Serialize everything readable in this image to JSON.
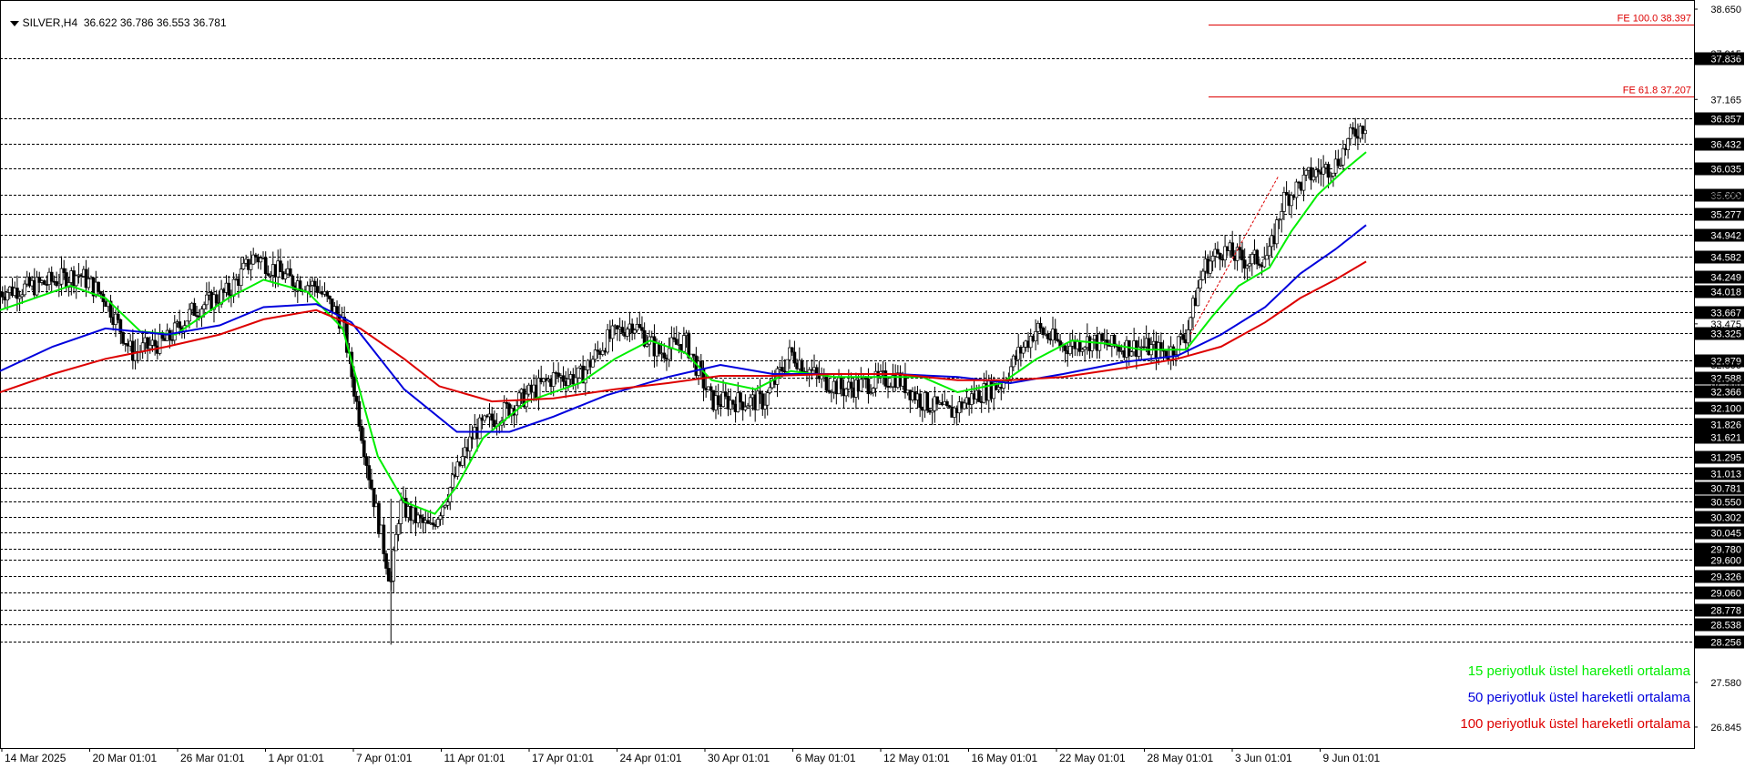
{
  "header": {
    "symbol": "SILVER,H4",
    "ohlc": "36.622 36.786 36.553 36.781"
  },
  "colors": {
    "ema15": "#00ee00",
    "ema50": "#0000dd",
    "ema100": "#dd0000",
    "candles": "#000000",
    "fib": "#dd0000",
    "grid": "#000000"
  },
  "chart_data": {
    "type": "line",
    "title": "SILVER,H4",
    "ylim": [
      26.5,
      38.8
    ],
    "price_scale_ticks": [
      "38.650",
      "37.915",
      "37.165",
      "35.595",
      "33.475",
      "32.800",
      "32.500",
      "27.580",
      "26.845"
    ],
    "level_labels": [
      "37.836",
      "36.857",
      "36.432",
      "36.035",
      "35.600",
      "35.277",
      "34.942",
      "34.582",
      "34.249",
      "34.018",
      "33.667",
      "33.325",
      "32.879",
      "32.588",
      "32.366",
      "32.100",
      "31.826",
      "31.621",
      "31.295",
      "31.013",
      "30.781",
      "30.550",
      "30.302",
      "30.045",
      "29.780",
      "29.600",
      "29.326",
      "29.060",
      "28.778",
      "28.538",
      "28.256"
    ],
    "x_labels": [
      "14 Mar 2025",
      "20 Mar 01:01",
      "26 Mar 01:01",
      "1 Apr 01:01",
      "7 Apr 01:01",
      "11 Apr 01:01",
      "17 Apr 01:01",
      "24 Apr 01:01",
      "30 Apr 01:01",
      "6 May 01:01",
      "12 May 01:01",
      "16 May 01:01",
      "22 May 01:01",
      "28 May 01:01",
      "3 Jun 01:01",
      "9 Jun 01:01"
    ],
    "fib_levels": [
      {
        "label": "FE 100.0 38.397",
        "value": 38.397
      },
      {
        "label": "FE 61.8 37.207",
        "value": 37.207
      }
    ],
    "price_path": [
      {
        "x": 0,
        "y": 34.0
      },
      {
        "x": 0.4,
        "y": 34.1
      },
      {
        "x": 0.9,
        "y": 34.3
      },
      {
        "x": 1.2,
        "y": 33.9
      },
      {
        "x": 1.5,
        "y": 33.0
      },
      {
        "x": 1.9,
        "y": 33.2
      },
      {
        "x": 2.2,
        "y": 33.7
      },
      {
        "x": 2.6,
        "y": 34.0
      },
      {
        "x": 2.9,
        "y": 34.6
      },
      {
        "x": 3.3,
        "y": 34.2
      },
      {
        "x": 3.6,
        "y": 34.1
      },
      {
        "x": 3.9,
        "y": 33.5
      },
      {
        "x": 4.2,
        "y": 31.0
      },
      {
        "x": 4.45,
        "y": 29.2
      },
      {
        "x": 4.55,
        "y": 30.5
      },
      {
        "x": 4.7,
        "y": 30.3
      },
      {
        "x": 4.9,
        "y": 30.1
      },
      {
        "x": 5.1,
        "y": 30.7
      },
      {
        "x": 5.4,
        "y": 31.7
      },
      {
        "x": 5.7,
        "y": 32.0
      },
      {
        "x": 6.0,
        "y": 32.3
      },
      {
        "x": 6.3,
        "y": 32.6
      },
      {
        "x": 6.6,
        "y": 32.6
      },
      {
        "x": 6.9,
        "y": 33.2
      },
      {
        "x": 7.2,
        "y": 33.5
      },
      {
        "x": 7.5,
        "y": 33.0
      },
      {
        "x": 7.8,
        "y": 33.2
      },
      {
        "x": 8.1,
        "y": 32.2
      },
      {
        "x": 8.4,
        "y": 32.2
      },
      {
        "x": 8.7,
        "y": 32.2
      },
      {
        "x": 9.0,
        "y": 33.0
      },
      {
        "x": 9.3,
        "y": 32.6
      },
      {
        "x": 9.6,
        "y": 32.4
      },
      {
        "x": 9.9,
        "y": 32.5
      },
      {
        "x": 10.2,
        "y": 32.6
      },
      {
        "x": 10.5,
        "y": 32.2
      },
      {
        "x": 10.8,
        "y": 32.0
      },
      {
        "x": 11.1,
        "y": 32.3
      },
      {
        "x": 11.4,
        "y": 32.5
      },
      {
        "x": 11.6,
        "y": 33.0
      },
      {
        "x": 11.8,
        "y": 33.4
      },
      {
        "x": 12.1,
        "y": 33.1
      },
      {
        "x": 12.4,
        "y": 33.2
      },
      {
        "x": 12.7,
        "y": 33.1
      },
      {
        "x": 13.0,
        "y": 33.1
      },
      {
        "x": 13.3,
        "y": 33.0
      },
      {
        "x": 13.5,
        "y": 33.3
      },
      {
        "x": 13.7,
        "y": 34.4
      },
      {
        "x": 13.9,
        "y": 34.7
      },
      {
        "x": 14.2,
        "y": 34.5
      },
      {
        "x": 14.45,
        "y": 34.6
      },
      {
        "x": 14.6,
        "y": 35.5
      },
      {
        "x": 14.9,
        "y": 35.9
      },
      {
        "x": 15.2,
        "y": 36.1
      },
      {
        "x": 15.4,
        "y": 36.6
      },
      {
        "x": 15.55,
        "y": 36.78
      }
    ],
    "series": [
      {
        "name": "15 periyotluk üstel hareketli ortalama",
        "color": "#00ee00",
        "points": [
          {
            "x": 0,
            "y": 33.7
          },
          {
            "x": 0.8,
            "y": 34.1
          },
          {
            "x": 1.2,
            "y": 33.9
          },
          {
            "x": 1.6,
            "y": 33.35
          },
          {
            "x": 2.0,
            "y": 33.3
          },
          {
            "x": 2.6,
            "y": 33.9
          },
          {
            "x": 3.0,
            "y": 34.2
          },
          {
            "x": 3.5,
            "y": 34.0
          },
          {
            "x": 3.9,
            "y": 33.4
          },
          {
            "x": 4.3,
            "y": 31.3
          },
          {
            "x": 4.6,
            "y": 30.55
          },
          {
            "x": 4.95,
            "y": 30.35
          },
          {
            "x": 5.2,
            "y": 30.8
          },
          {
            "x": 5.5,
            "y": 31.6
          },
          {
            "x": 6.0,
            "y": 32.2
          },
          {
            "x": 6.6,
            "y": 32.5
          },
          {
            "x": 7.0,
            "y": 32.9
          },
          {
            "x": 7.4,
            "y": 33.2
          },
          {
            "x": 7.8,
            "y": 33.0
          },
          {
            "x": 8.1,
            "y": 32.55
          },
          {
            "x": 8.6,
            "y": 32.4
          },
          {
            "x": 9.0,
            "y": 32.7
          },
          {
            "x": 9.5,
            "y": 32.6
          },
          {
            "x": 10.0,
            "y": 32.6
          },
          {
            "x": 10.5,
            "y": 32.6
          },
          {
            "x": 10.9,
            "y": 32.35
          },
          {
            "x": 11.4,
            "y": 32.5
          },
          {
            "x": 11.8,
            "y": 32.9
          },
          {
            "x": 12.2,
            "y": 33.2
          },
          {
            "x": 12.6,
            "y": 33.15
          },
          {
            "x": 13.0,
            "y": 33.05
          },
          {
            "x": 13.5,
            "y": 33.05
          },
          {
            "x": 13.8,
            "y": 33.6
          },
          {
            "x": 14.1,
            "y": 34.1
          },
          {
            "x": 14.45,
            "y": 34.4
          },
          {
            "x": 14.7,
            "y": 35.0
          },
          {
            "x": 15.0,
            "y": 35.6
          },
          {
            "x": 15.3,
            "y": 36.0
          },
          {
            "x": 15.55,
            "y": 36.3
          }
        ]
      },
      {
        "name": "50 periyotluk üstel hareketli ortalama",
        "color": "#0000dd",
        "points": [
          {
            "x": 0,
            "y": 32.7
          },
          {
            "x": 0.6,
            "y": 33.1
          },
          {
            "x": 1.2,
            "y": 33.4
          },
          {
            "x": 1.9,
            "y": 33.3
          },
          {
            "x": 2.5,
            "y": 33.45
          },
          {
            "x": 3.0,
            "y": 33.75
          },
          {
            "x": 3.6,
            "y": 33.8
          },
          {
            "x": 4.0,
            "y": 33.5
          },
          {
            "x": 4.6,
            "y": 32.4
          },
          {
            "x": 5.2,
            "y": 31.7
          },
          {
            "x": 5.8,
            "y": 31.7
          },
          {
            "x": 6.3,
            "y": 31.95
          },
          {
            "x": 6.9,
            "y": 32.3
          },
          {
            "x": 7.6,
            "y": 32.6
          },
          {
            "x": 8.2,
            "y": 32.8
          },
          {
            "x": 8.8,
            "y": 32.65
          },
          {
            "x": 9.5,
            "y": 32.65
          },
          {
            "x": 10.2,
            "y": 32.65
          },
          {
            "x": 10.9,
            "y": 32.6
          },
          {
            "x": 11.5,
            "y": 32.5
          },
          {
            "x": 12.1,
            "y": 32.65
          },
          {
            "x": 12.8,
            "y": 32.85
          },
          {
            "x": 13.4,
            "y": 32.95
          },
          {
            "x": 13.9,
            "y": 33.3
          },
          {
            "x": 14.4,
            "y": 33.75
          },
          {
            "x": 14.8,
            "y": 34.3
          },
          {
            "x": 15.2,
            "y": 34.7
          },
          {
            "x": 15.55,
            "y": 35.1
          }
        ]
      },
      {
        "name": "100 periyotluk üstel hareketli ortalama",
        "color": "#dd0000",
        "points": [
          {
            "x": 0,
            "y": 32.35
          },
          {
            "x": 0.6,
            "y": 32.65
          },
          {
            "x": 1.2,
            "y": 32.9
          },
          {
            "x": 1.9,
            "y": 33.1
          },
          {
            "x": 2.5,
            "y": 33.3
          },
          {
            "x": 3.0,
            "y": 33.55
          },
          {
            "x": 3.6,
            "y": 33.7
          },
          {
            "x": 4.1,
            "y": 33.4
          },
          {
            "x": 4.6,
            "y": 32.9
          },
          {
            "x": 5.0,
            "y": 32.45
          },
          {
            "x": 5.6,
            "y": 32.2
          },
          {
            "x": 6.3,
            "y": 32.25
          },
          {
            "x": 7.0,
            "y": 32.4
          },
          {
            "x": 7.6,
            "y": 32.5
          },
          {
            "x": 8.2,
            "y": 32.62
          },
          {
            "x": 8.8,
            "y": 32.62
          },
          {
            "x": 9.5,
            "y": 32.65
          },
          {
            "x": 10.2,
            "y": 32.65
          },
          {
            "x": 10.9,
            "y": 32.55
          },
          {
            "x": 11.5,
            "y": 32.55
          },
          {
            "x": 12.1,
            "y": 32.6
          },
          {
            "x": 12.8,
            "y": 32.75
          },
          {
            "x": 13.4,
            "y": 32.9
          },
          {
            "x": 13.9,
            "y": 33.1
          },
          {
            "x": 14.4,
            "y": 33.5
          },
          {
            "x": 14.8,
            "y": 33.9
          },
          {
            "x": 15.2,
            "y": 34.2
          },
          {
            "x": 15.55,
            "y": 34.5
          }
        ]
      }
    ]
  }
}
